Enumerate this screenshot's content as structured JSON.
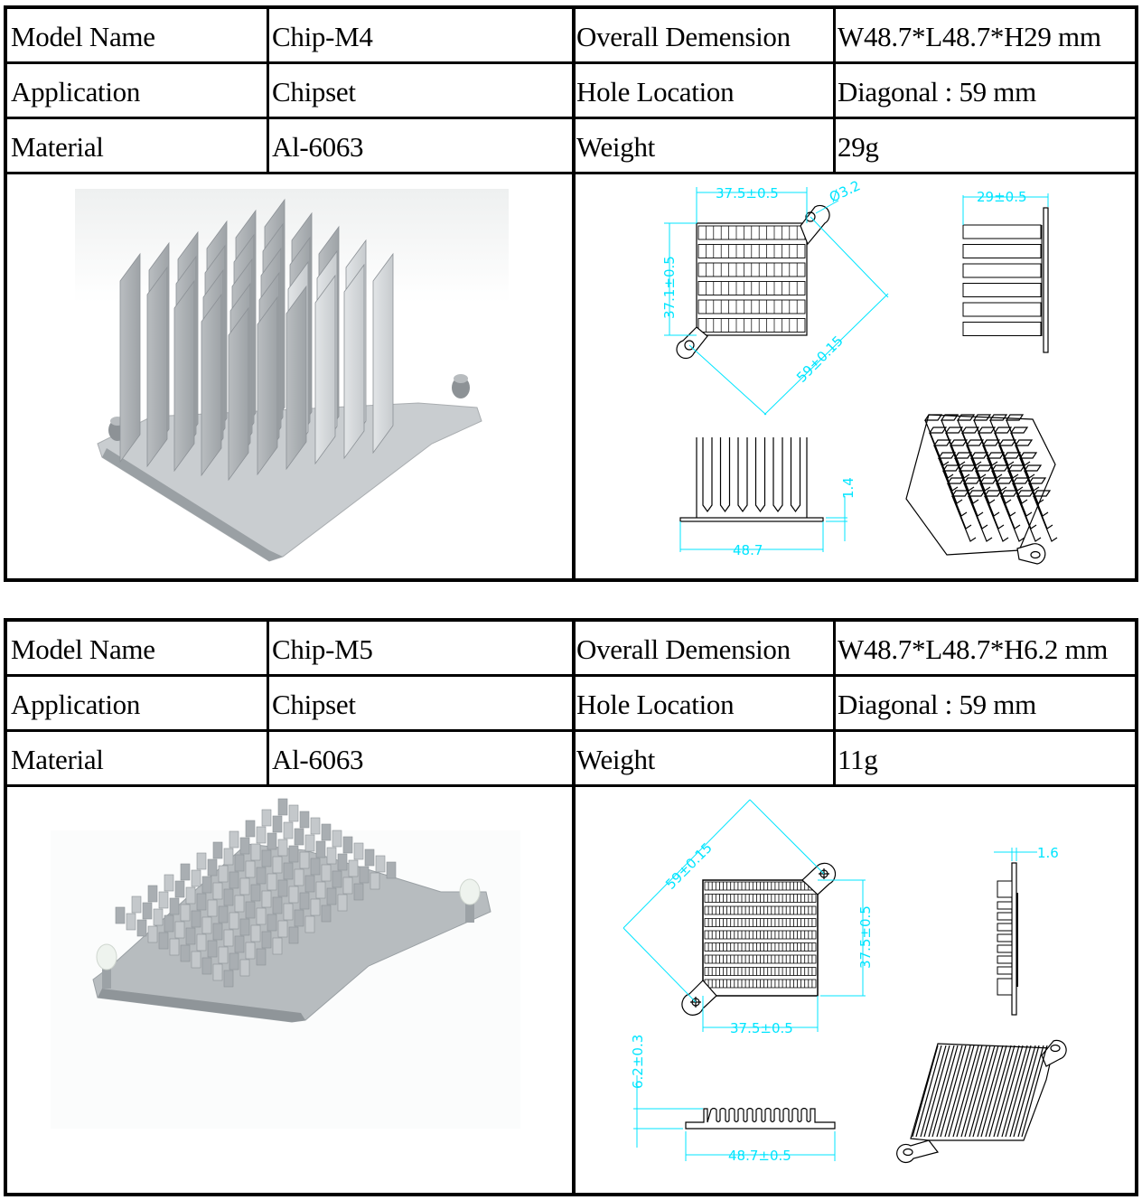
{
  "products": [
    {
      "specs": [
        {
          "label": "Model Name",
          "value": "Chip-M4",
          "label2": "Overall Demension",
          "value2": "W48.7*L48.7*H29 mm"
        },
        {
          "label": "Application",
          "value": "Chipset",
          "label2": "Hole Location",
          "value2": "Diagonal : 59 mm"
        },
        {
          "label": "Material",
          "value": "Al-6063",
          "label2": "Weight",
          "value2": "29g"
        }
      ],
      "photo": "heatsink-photo-tall-fins",
      "drawing": {
        "top_width": "37.5±0.5",
        "top_height": "37.1±0.5",
        "hole_dia": "Ø3.2",
        "diagonal": "59±0.15",
        "side_depth": "29±0.5",
        "base_thickness": "1.4",
        "front_width": "48.7"
      }
    },
    {
      "specs": [
        {
          "label": "Model Name",
          "value": "Chip-M5",
          "label2": "Overall Demension",
          "value2": "W48.7*L48.7*H6.2 mm"
        },
        {
          "label": "Application",
          "value": "Chipset",
          "label2": "Hole Location",
          "value2": "Diagonal : 59 mm"
        },
        {
          "label": "Material",
          "value": "Al-6063",
          "label2": "Weight",
          "value2": "11g"
        }
      ],
      "photo": "heatsink-photo-low-profile",
      "drawing": {
        "diagonal": "59±0.15",
        "top_height": "37.5±0.5",
        "top_width": "37.5±0.5",
        "side_thickness": "1.6",
        "front_height": "6.2±0.3",
        "front_width": "48.7±0.5"
      }
    }
  ],
  "colors": {
    "dimension": "#00e5ff",
    "border": "#000000",
    "aluminum": "#c8ccd0"
  }
}
